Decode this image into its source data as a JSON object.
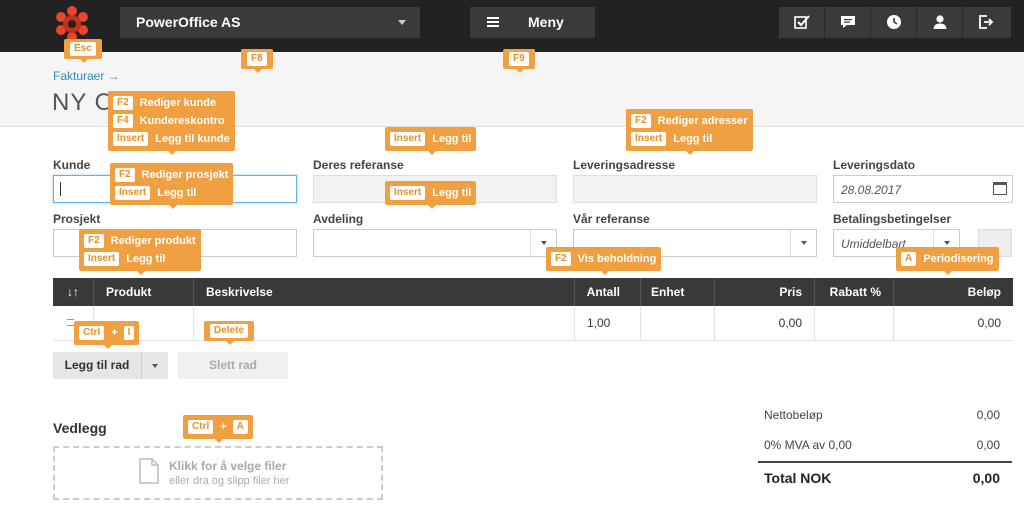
{
  "app": {
    "company": "PowerOffice AS",
    "menu_label": "Meny"
  },
  "breadcrumb": "Fakturaer →",
  "page_title": "NY O",
  "form": {
    "kunde_label": "Kunde",
    "deres_referanse_label": "Deres referanse",
    "leveringsadresse_label": "Leveringsadresse",
    "leveringsdato_label": "Leveringsdato",
    "leveringsdato_value": "28.08.2017",
    "prosjekt_label": "Prosjekt",
    "avdeling_label": "Avdeling",
    "var_referanse_label": "Vår referanse",
    "betalingsbetingelser_label": "Betalingsbetingelser",
    "betalingsbetingelser_value": "Umiddelbart"
  },
  "table": {
    "sort_label": "↓↑",
    "headers": [
      "Produkt",
      "Beskrivelse",
      "Antall",
      "Enhet",
      "Pris",
      "Rabatt %",
      "Beløp"
    ],
    "row": {
      "antall": "1,00",
      "pris": "0,00",
      "belop": "0,00"
    }
  },
  "buttons": {
    "legg_til_rad": "Legg til rad",
    "slett_rad": "Slett rad"
  },
  "attachments": {
    "title": "Vedlegg",
    "line1": "Klikk for å velge filer",
    "line2": "eller dra og slipp filer her"
  },
  "totals": {
    "netto_label": "Nettobeløp",
    "netto_value": "0,00",
    "mva_label": "0% MVA av 0,00",
    "mva_value": "0,00",
    "total_label": "Total NOK",
    "total_value": "0,00"
  },
  "hints": {
    "esc": {
      "key": "Esc"
    },
    "f8": {
      "key": "F8"
    },
    "f9": {
      "key": "F9"
    },
    "kunde": [
      {
        "key": "F2",
        "text": "Rediger kunde"
      },
      {
        "key": "F4",
        "text": "Kundereskontro"
      },
      {
        "key": "Insert",
        "text": "Legg til kunde"
      }
    ],
    "prosjekt": [
      {
        "key": "F2",
        "text": "Rediger prosjekt"
      },
      {
        "key": "Insert",
        "text": "Legg til"
      }
    ],
    "produkt": [
      {
        "key": "F2",
        "text": "Rediger produkt"
      },
      {
        "key": "Insert",
        "text": "Legg til"
      }
    ],
    "deres_ref": {
      "key": "Insert",
      "text": "Legg til"
    },
    "avdeling": {
      "key": "Insert",
      "text": "Legg til"
    },
    "adresse": [
      {
        "key": "F2",
        "text": "Rediger adresser"
      },
      {
        "key": "Insert",
        "text": "Legg til"
      }
    ],
    "beholdning": {
      "key": "F2",
      "text": "Vis beholdning"
    },
    "periodisering": {
      "key": "A",
      "text": "Periodisering"
    },
    "ctrl_i": {
      "k1": "Ctrl",
      "plus": "+",
      "k2": "I"
    },
    "delete": {
      "key": "Delete"
    },
    "ctrl_a": {
      "k1": "Ctrl",
      "plus": "+",
      "k2": "A"
    }
  },
  "colors": {
    "accent": "#f0a040",
    "topbar": "#222222",
    "link": "#2c8fbd",
    "table_header": "#393939"
  }
}
